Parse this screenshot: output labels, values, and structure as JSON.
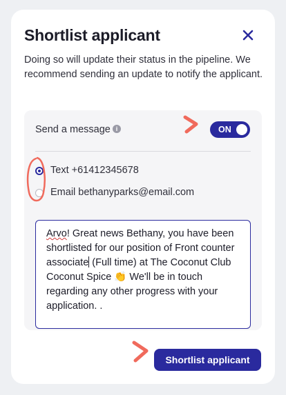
{
  "modal": {
    "title": "Shortlist applicant",
    "description": "Doing so will update their status in the pipeline. We recommend sending an update to notify the applicant."
  },
  "message_settings": {
    "send_label": "Send a message",
    "toggle_state": "ON",
    "options": [
      {
        "label": "Text +61412345678",
        "checked": true
      },
      {
        "label": "Email bethanyparks@email.com",
        "checked": false
      }
    ]
  },
  "message": {
    "misspelled_word": "Arvo",
    "line1_rest": "! Great news Bethany, you have been shortlisted for our position of Front counter associate",
    "line_after_caret": " (Full time) at The Coconut Club Coconut Spice 👏 We'll be in touch regarding any other progress with your application. ."
  },
  "actions": {
    "primary_label": "Shortlist applicant"
  },
  "colors": {
    "primary": "#2a2a9e",
    "annotation": "#f06a5c"
  }
}
